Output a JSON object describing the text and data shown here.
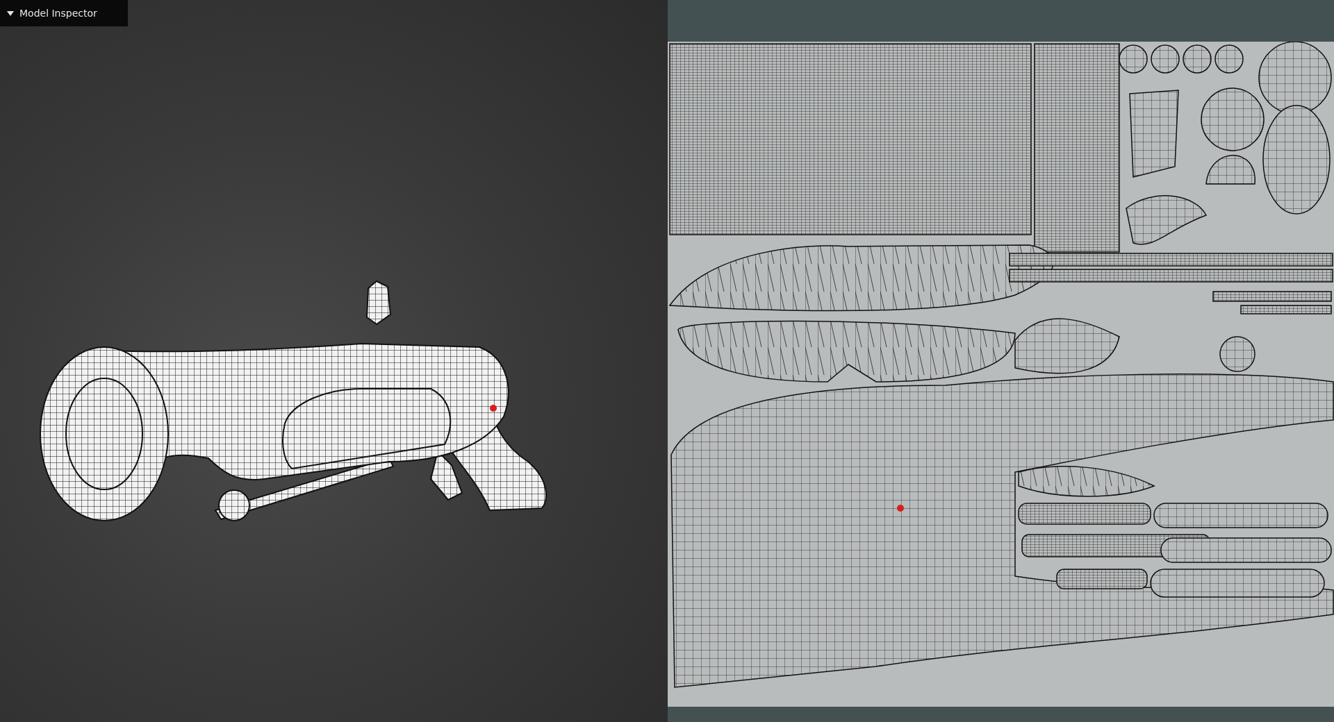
{
  "inspector": {
    "title": "Model Inspector",
    "expanded": true
  }
}
